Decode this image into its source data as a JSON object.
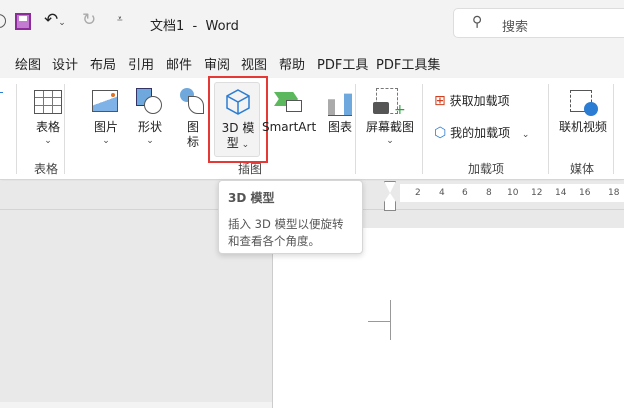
{
  "titlebar": {
    "title": "文档1  -  Word",
    "search_placeholder": "搜索"
  },
  "tabs": [
    "绘图",
    "设计",
    "布局",
    "引用",
    "邮件",
    "审阅",
    "视图",
    "帮助",
    "PDF工具",
    "PDF工具集"
  ],
  "ribbon": {
    "table": {
      "button": "表格",
      "group": "表格"
    },
    "illustrations": {
      "picture": "图片",
      "shapes": "形状",
      "icons_l1": "图",
      "icons_l2": "标",
      "model_l1": "3D 模",
      "model_l2": "型",
      "smartart": "SmartArt",
      "chart": "图表",
      "screenshot": "屏幕截图",
      "group": "插图"
    },
    "addins": {
      "get": "获取加载项",
      "mine": "我的加载项",
      "group": "加载项"
    },
    "media": {
      "video": "联机视频",
      "group": "媒体"
    }
  },
  "tooltip": {
    "title": "3D 模型",
    "line1": "插入 3D 模型以便旋转",
    "line2": "和查看各个角度。"
  },
  "ruler": [
    "2",
    "4",
    "6",
    "8",
    "10",
    "12",
    "14",
    "16",
    "18"
  ],
  "colors": {
    "highlight": "#e53935",
    "accent": "#2b7cd3"
  }
}
